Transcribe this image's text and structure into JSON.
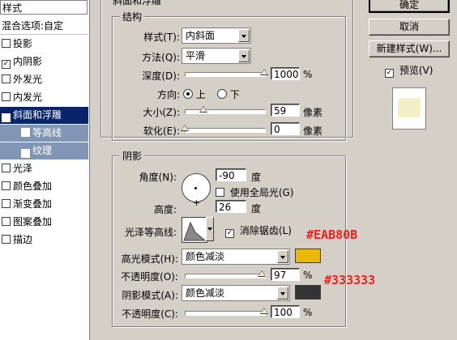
{
  "left_panel": {
    "header": "样式",
    "blend_options": "混合选项:自定",
    "items": [
      {
        "label": "投影",
        "checked": false
      },
      {
        "label": "内阴影",
        "checked": true
      },
      {
        "label": "外发光",
        "checked": false
      },
      {
        "label": "内发光",
        "checked": false
      },
      {
        "label": "斜面和浮雕",
        "checked": true
      },
      {
        "label": "等高线",
        "checked": false
      },
      {
        "label": "纹理",
        "checked": true
      },
      {
        "label": "光泽",
        "checked": false
      },
      {
        "label": "颜色叠加",
        "checked": false
      },
      {
        "label": "渐变叠加",
        "checked": false
      },
      {
        "label": "图案叠加",
        "checked": false
      },
      {
        "label": "描边",
        "checked": false
      }
    ]
  },
  "top_title": "斜面和浮雕",
  "structure": {
    "legend": "结构",
    "style_label": "样式(T):",
    "style_value": "内斜面",
    "technique_label": "方法(Q):",
    "technique_value": "平滑",
    "depth_label": "深度(D):",
    "depth_value": "1000",
    "depth_unit": "%",
    "depth_level": 1.0,
    "direction_label": "方向:",
    "dir_up": "上",
    "dir_down": "下",
    "size_label": "大小(Z):",
    "size_value": "59",
    "size_unit": "像素",
    "size_level": 0.23,
    "soften_label": "软化(E):",
    "soften_value": "0",
    "soften_unit": "像素",
    "soften_level": 0.0
  },
  "shading": {
    "legend": "阴影",
    "angle_label": "角度(N):",
    "angle_value": "-90",
    "angle_unit": "度",
    "global_light_label": "使用全局光(G)",
    "altitude_label": "高度:",
    "altitude_value": "26",
    "altitude_unit": "度",
    "gloss_label": "光泽等高线:",
    "antialias_label": "消除锯齿(L)",
    "highlight_label": "高光模式(H):",
    "highlight_mode": "颜色减淡",
    "highlight_color": "#EAB80B",
    "opacity1_label": "不透明度(O):",
    "opacity1_value": "97",
    "opacity1_unit": "%",
    "opacity1_level": 0.97,
    "shadow_label": "阴影模式(A):",
    "shadow_mode": "颜色减淡",
    "shadow_color": "#333333",
    "opacity2_label": "不透明度(C):",
    "opacity2_value": "100",
    "opacity2_unit": "%",
    "opacity2_level": 1.0
  },
  "buttons": {
    "ok": "确定",
    "cancel": "取消",
    "new_style": "新建样式(W)...",
    "preview": "预览(V)"
  },
  "annotations": {
    "highlight_hex": "#EAB80B",
    "shadow_hex": "#333333"
  }
}
